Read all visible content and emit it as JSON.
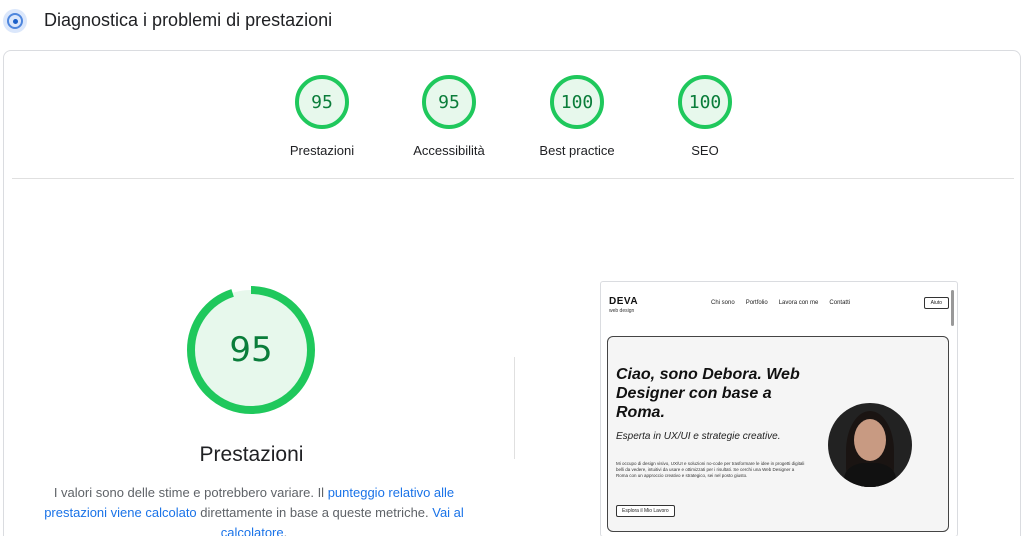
{
  "header": {
    "title": "Diagnostica i problemi di prestazioni",
    "icon": "lighthouse-icon"
  },
  "gauges": [
    {
      "value": "95",
      "label": "Prestazioni",
      "score": 95
    },
    {
      "value": "95",
      "label": "Accessibilità",
      "score": 95
    },
    {
      "value": "100",
      "label": "Best practice",
      "score": 100
    },
    {
      "value": "100",
      "label": "SEO",
      "score": 100
    }
  ],
  "main": {
    "score": "95",
    "score_fraction": 0.95,
    "title": "Prestazioni",
    "desc_1": "I valori sono delle stime e potrebbero variare. Il ",
    "link_1": "punteggio relativo alle prestazioni viene calcolato",
    "desc_2": " direttamente in base a queste metriche. ",
    "link_2": "Vai al calcolatore",
    "desc_3": "."
  },
  "preview": {
    "logo": "DEVA",
    "logo_sub": "web design",
    "nav": [
      "Chi sono",
      "Portfolio",
      "Lavora con me",
      "Contatti"
    ],
    "help": "Aiuto",
    "hero_title": "Ciao, sono Debora. Web Designer con base a Roma.",
    "hero_subtitle": "Esperta in UX/UI e strategie creative.",
    "hero_text": "Mi occupo di design visivo, UX/UI e soluzioni no-code per trasformare le idee in progetti digitali belli da vedere, intuitivi da usare e ottimizzati per i risultati. Se cerchi una Web Designer a Roma con un approccio creativo e strategico, sei nel posto giusto.",
    "hero_button": "Esplora il Mio Lavoro"
  },
  "colors": {
    "pass": "#1fc85c",
    "pass_text": "#0a7d3a",
    "pass_bg": "#e7f8ec",
    "link": "#1a73e8"
  }
}
